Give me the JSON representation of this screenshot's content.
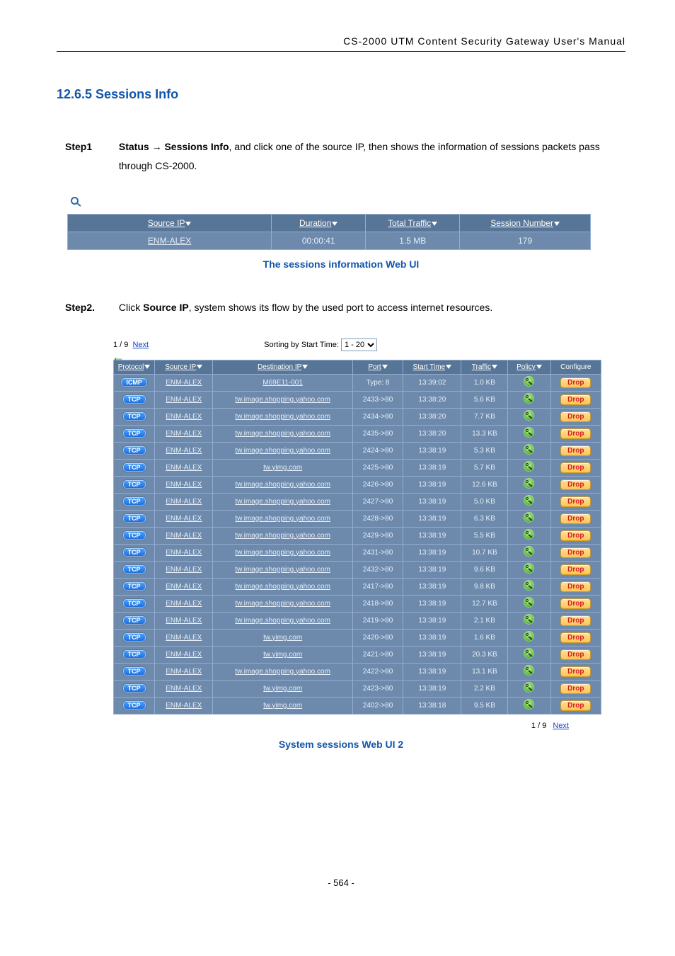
{
  "doc_header": "CS-2000 UTM Content Security Gateway User's Manual",
  "section_title": "12.6.5 Sessions Info",
  "step1": {
    "label": "Step1",
    "body_prefix": "Status → ",
    "body_bold": "Sessions Info",
    "body_suffix": ", and click one of the source IP, then shows the information of sessions packets pass through CS-2000."
  },
  "table1": {
    "headers": [
      "Source IP",
      "Duration",
      "Total Traffic",
      "Session Number"
    ],
    "row": {
      "source": "ENM-ALEX",
      "duration": "00:00:41",
      "traffic": "1.5 MB",
      "sessions": "179"
    }
  },
  "caption1": "The sessions information Web UI",
  "step2": {
    "label": "Step2.",
    "body_pre": "Click ",
    "body_bold": "Source IP",
    "body_post": ", system shows its flow by the used port to access internet resources."
  },
  "pager_top": {
    "text": "1 / 9",
    "next": "Next"
  },
  "sort_label": "Sorting by Start Time:",
  "sort_options": [
    "1 - 20"
  ],
  "table2": {
    "headers": [
      "Protocol",
      "Source IP",
      "Destination IP",
      "Port",
      "Start Time",
      "Traffic",
      "Policy",
      "Configure"
    ],
    "rows": [
      {
        "proto": "ICMP",
        "src": "ENM-ALEX",
        "dst": "M69E11-001",
        "port": "Type: 8",
        "time": "13:39:02",
        "traffic": "1.0 KB"
      },
      {
        "proto": "TCP",
        "src": "ENM-ALEX",
        "dst": "tw.image.shopping.yahoo.com",
        "port": "2433->80",
        "time": "13:38:20",
        "traffic": "5.6 KB"
      },
      {
        "proto": "TCP",
        "src": "ENM-ALEX",
        "dst": "tw.image.shopping.yahoo.com",
        "port": "2434->80",
        "time": "13:38:20",
        "traffic": "7.7 KB"
      },
      {
        "proto": "TCP",
        "src": "ENM-ALEX",
        "dst": "tw.image.shopping.yahoo.com",
        "port": "2435->80",
        "time": "13:38:20",
        "traffic": "13.3 KB"
      },
      {
        "proto": "TCP",
        "src": "ENM-ALEX",
        "dst": "tw.image.shopping.yahoo.com",
        "port": "2424->80",
        "time": "13:38:19",
        "traffic": "5.3 KB"
      },
      {
        "proto": "TCP",
        "src": "ENM-ALEX",
        "dst": "tw.yimg.com",
        "port": "2425->80",
        "time": "13:38:19",
        "traffic": "5.7 KB"
      },
      {
        "proto": "TCP",
        "src": "ENM-ALEX",
        "dst": "tw.image.shopping.yahoo.com",
        "port": "2426->80",
        "time": "13:38:19",
        "traffic": "12.6 KB"
      },
      {
        "proto": "TCP",
        "src": "ENM-ALEX",
        "dst": "tw.image.shopping.yahoo.com",
        "port": "2427->80",
        "time": "13:38:19",
        "traffic": "5.0 KB"
      },
      {
        "proto": "TCP",
        "src": "ENM-ALEX",
        "dst": "tw.image.shopping.yahoo.com",
        "port": "2428->80",
        "time": "13:38:19",
        "traffic": "6.3 KB"
      },
      {
        "proto": "TCP",
        "src": "ENM-ALEX",
        "dst": "tw.image.shopping.yahoo.com",
        "port": "2429->80",
        "time": "13:38:19",
        "traffic": "5.5 KB"
      },
      {
        "proto": "TCP",
        "src": "ENM-ALEX",
        "dst": "tw.image.shopping.yahoo.com",
        "port": "2431->80",
        "time": "13:38:19",
        "traffic": "10.7 KB"
      },
      {
        "proto": "TCP",
        "src": "ENM-ALEX",
        "dst": "tw.image.shopping.yahoo.com",
        "port": "2432->80",
        "time": "13:38:19",
        "traffic": "9.6 KB"
      },
      {
        "proto": "TCP",
        "src": "ENM-ALEX",
        "dst": "tw.image.shopping.yahoo.com",
        "port": "2417->80",
        "time": "13:38:19",
        "traffic": "9.8 KB"
      },
      {
        "proto": "TCP",
        "src": "ENM-ALEX",
        "dst": "tw.image.shopping.yahoo.com",
        "port": "2418->80",
        "time": "13:38:19",
        "traffic": "12.7 KB"
      },
      {
        "proto": "TCP",
        "src": "ENM-ALEX",
        "dst": "tw.image.shopping.yahoo.com",
        "port": "2419->80",
        "time": "13:38:19",
        "traffic": "2.1 KB"
      },
      {
        "proto": "TCP",
        "src": "ENM-ALEX",
        "dst": "tw.yimg.com",
        "port": "2420->80",
        "time": "13:38:19",
        "traffic": "1.6 KB"
      },
      {
        "proto": "TCP",
        "src": "ENM-ALEX",
        "dst": "tw.yimg.com",
        "port": "2421->80",
        "time": "13:38:19",
        "traffic": "20.3 KB"
      },
      {
        "proto": "TCP",
        "src": "ENM-ALEX",
        "dst": "tw.image.shopping.yahoo.com",
        "port": "2422->80",
        "time": "13:38:19",
        "traffic": "13.1 KB"
      },
      {
        "proto": "TCP",
        "src": "ENM-ALEX",
        "dst": "tw.yimg.com",
        "port": "2423->80",
        "time": "13:38:19",
        "traffic": "2.2 KB"
      },
      {
        "proto": "TCP",
        "src": "ENM-ALEX",
        "dst": "tw.yimg.com",
        "port": "2402->80",
        "time": "13:38:18",
        "traffic": "9.5 KB"
      }
    ],
    "drop_label": "Drop"
  },
  "pager_bottom": {
    "text": "1 / 9",
    "next": "Next"
  },
  "caption2": "System sessions Web UI 2",
  "page_number": "- 564 -"
}
